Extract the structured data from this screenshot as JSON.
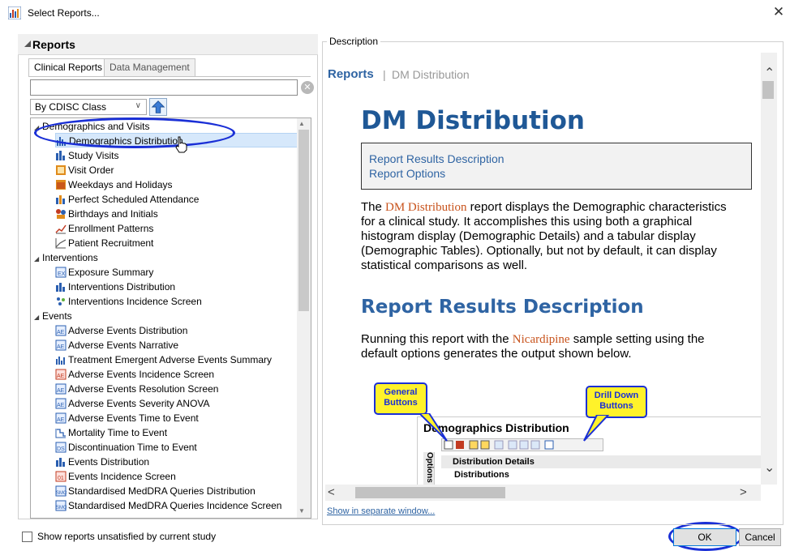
{
  "window": {
    "title": "Select Reports...",
    "close_glyph": "✕"
  },
  "left_panel": {
    "header": "Reports",
    "tabs": [
      {
        "label": "Clinical Reports"
      },
      {
        "label": "Data Management"
      }
    ],
    "search": {
      "value": "",
      "clear_glyph": "✕"
    },
    "class_select": {
      "value": "By CDISC Class",
      "chevron": "∨"
    },
    "tree": {
      "groups": [
        {
          "label": "Demographics and Visits",
          "items": [
            "Demographics Distribution",
            "Study Visits",
            "Visit Order",
            "Weekdays and Holidays",
            "Perfect Scheduled Attendance",
            "Birthdays and Initials",
            "Enrollment Patterns",
            "Patient Recruitment"
          ]
        },
        {
          "label": "Interventions",
          "items": [
            "Exposure Summary",
            "Interventions Distribution",
            "Interventions Incidence Screen"
          ]
        },
        {
          "label": "Events",
          "items": [
            "Adverse Events Distribution",
            "Adverse Events Narrative",
            "Treatment Emergent Adverse Events Summary",
            "Adverse Events Incidence Screen",
            "Adverse Events Resolution Screen",
            "Adverse Events Severity ANOVA",
            "Adverse Events Time to Event",
            "Mortality Time to Event",
            "Discontinuation Time to Event",
            "Events Distribution",
            "Events Incidence Screen",
            "Standardised MedDRA Queries Distribution",
            "Standardised MedDRA Queries Incidence Screen"
          ]
        }
      ],
      "selected": "Demographics Distribution"
    },
    "show_unsatisfied_label": "Show reports unsatisfied by current study",
    "show_unsatisfied_checked": false
  },
  "description": {
    "group_label": "Description",
    "breadcrumb": {
      "root": "Reports",
      "sep": "|",
      "page": "DM Distribution"
    },
    "title": "DM Distribution",
    "toc": [
      "Report Results Description",
      "Report Options"
    ],
    "intro": {
      "before": "The ",
      "highlight": "DM Distribution",
      "after": " report displays the Demographic characteristics for a clinical study. It accomplishes this using both a graphical histogram display (Demographic Details) and a tabular display (Demographic Tables). Optionally, but not by default, it can display statistical comparisons as well."
    },
    "section_title": "Report Results Description",
    "running": {
      "before": "Running this report with the ",
      "highlight": "Nicardipine",
      "after": " sample setting using the default options generates the output shown below."
    },
    "screenshot": {
      "title": "Demographics Distribution",
      "options_label": "Options",
      "distribution_details": "Distribution Details",
      "distributions": "Distributions",
      "callout_general": "General Buttons",
      "callout_drill": "Drill Down Buttons"
    },
    "show_separate_link": "Show in separate window..."
  },
  "buttons": {
    "ok": "OK",
    "cancel": "Cancel"
  },
  "colors": {
    "accent": "#2f64a3",
    "highlight_text": "#c8531c",
    "annotation_oval": "#1a2fd6",
    "callout_fill": "#fff22a",
    "selection": "#d6e8fb"
  },
  "icons": {
    "app": "report-chart-icon",
    "tree_items": [
      "distribution-icon",
      "study-visits-icon",
      "visit-order-icon",
      "calendar-icon",
      "attendance-icon",
      "birthday-icon",
      "enrollment-icon",
      "recruitment-icon",
      "exposure-icon",
      "interventions-distribution-icon",
      "incidence-screen-icon",
      "ae-distribution-icon",
      "ae-narrative-icon",
      "teae-summary-icon",
      "ae-incidence-icon",
      "ae-resolution-icon",
      "ae-severity-icon",
      "ae-time-to-event-icon",
      "mortality-icon",
      "discontinuation-icon",
      "events-distribution-icon",
      "events-incidence-icon",
      "smq-distribution-icon",
      "smq-incidence-icon"
    ]
  }
}
